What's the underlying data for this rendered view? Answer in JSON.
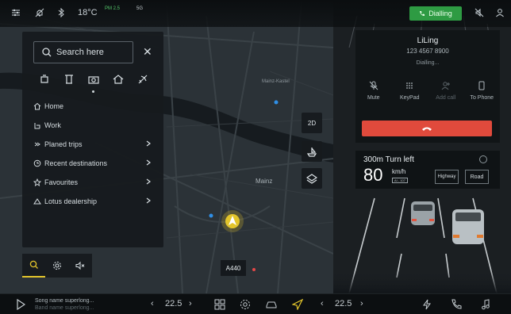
{
  "status_bar": {
    "temperature": "18°C",
    "aqi_label": "PM 2.5",
    "signal_label": "5G",
    "dialling_label": "Dialling"
  },
  "search_panel": {
    "placeholder": "Search here",
    "categories": [
      "restaurant-icon",
      "hotel-icon",
      "camera-icon",
      "parking-icon",
      "airport-icon"
    ],
    "items": [
      {
        "label": "Home",
        "icon": "home-icon",
        "has_chevron": false
      },
      {
        "label": "Work",
        "icon": "work-icon",
        "has_chevron": false
      },
      {
        "label": "Planed trips",
        "icon": "trip-icon",
        "has_chevron": true
      },
      {
        "label": "Recent destinations",
        "icon": "clock-icon",
        "has_chevron": true
      },
      {
        "label": "Favourites",
        "icon": "star-icon",
        "has_chevron": true
      },
      {
        "label": "Lotus dealership",
        "icon": "dealership-icon",
        "has_chevron": true
      }
    ]
  },
  "map": {
    "view_mode": "2D",
    "city_label": "Mainz",
    "road_label": "A440",
    "small_labels": [
      "Mainz-Kastel"
    ]
  },
  "call": {
    "name": "LiLing",
    "number": "123 4567 8900",
    "status": "Dialling...",
    "actions": [
      {
        "label": "Mute",
        "icon": "mic-off-icon",
        "enabled": true
      },
      {
        "label": "KeyPad",
        "icon": "keypad-icon",
        "enabled": true
      },
      {
        "label": "Add call",
        "icon": "add-user-icon",
        "enabled": false
      },
      {
        "label": "To Phone",
        "icon": "phone-device-icon",
        "enabled": true
      }
    ],
    "hangup_color": "#e04a3c"
  },
  "navigation": {
    "instruction": "300m Turn left",
    "speed": "80",
    "unit_top": "km/",
    "unit_bottom": "h",
    "limit_text": "AI - 107",
    "highway_label": "Highway",
    "road_label": "Road"
  },
  "media": {
    "song": "Song name superlong...",
    "artist": "Band name superlong..."
  },
  "climate": {
    "left_temp": "22.5",
    "right_temp": "22.5"
  },
  "colors": {
    "accent_yellow": "#e3c52b",
    "dialling_green": "#2e9b43",
    "hangup_red": "#e04a3c"
  }
}
